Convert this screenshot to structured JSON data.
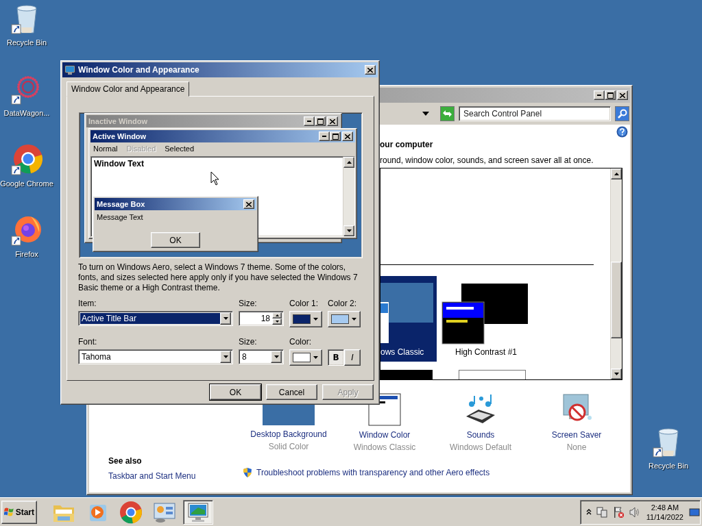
{
  "desktop_icons": [
    {
      "label": "Recycle Bin",
      "kind": "recycle-bin"
    },
    {
      "label": "DataWagon...",
      "kind": "datawagon"
    },
    {
      "label": "Google Chrome",
      "kind": "chrome"
    },
    {
      "label": "Firefox",
      "kind": "firefox"
    }
  ],
  "corner_icon": {
    "label": "Recycle Bin",
    "kind": "recycle-bin"
  },
  "control_panel": {
    "search": {
      "placeholder": "Search Control Panel"
    },
    "heading": "our computer",
    "description": "round, window color, sounds, and screen saver all at once.",
    "themes": [
      {
        "label": "ows Classic",
        "kind": "classic",
        "selected": true
      },
      {
        "label": "High Contrast #1",
        "kind": "high-contrast",
        "selected": false
      }
    ],
    "items": [
      {
        "label": "Desktop Background",
        "detail": "Solid Color",
        "kind": "background"
      },
      {
        "label": "Window Color",
        "detail": "Windows Classic",
        "kind": "window"
      },
      {
        "label": "Sounds",
        "detail": "Windows Default",
        "kind": "sounds"
      },
      {
        "label": "Screen Saver",
        "detail": "None",
        "kind": "screensaver"
      }
    ],
    "see_also": {
      "title": "See also",
      "links": [
        "Taskbar and Start Menu"
      ]
    },
    "troubleshoot": "Troubleshoot problems with transparency and other Aero effects"
  },
  "dialog": {
    "title": "Window Color and Appearance",
    "tabs": [
      {
        "label": "Window Color and Appearance",
        "selected": true
      }
    ],
    "preview": {
      "inactive_title": "Inactive Window",
      "active_title": "Active Window",
      "menu": [
        {
          "label": "Normal",
          "disabled": false
        },
        {
          "label": "Disabled",
          "disabled": true
        },
        {
          "label": "Selected",
          "disabled": false
        }
      ],
      "window_text": "Window Text",
      "message_title": "Message Box",
      "message_text": "Message Text",
      "ok": "OK"
    },
    "note": "To turn on Windows Aero, select a Windows 7 theme.  Some of the colors, fonts, and sizes selected here apply only if you have selected the Windows 7 Basic theme or a High Contrast theme.",
    "item": {
      "label": "Item:",
      "value": "Active Title Bar"
    },
    "item_size": {
      "label": "Size:",
      "value": "18"
    },
    "color1": {
      "label": "Color 1:",
      "color": "#0a246a"
    },
    "color2": {
      "label": "Color 2:",
      "color": "#a6caf0"
    },
    "font": {
      "label": "Font:",
      "value": "Tahoma"
    },
    "font_size": {
      "label": "Size:",
      "value": "8"
    },
    "font_color": {
      "label": "Color:",
      "color": "#ffffff"
    },
    "bold": {
      "label": "B",
      "selected": true
    },
    "italic": {
      "label": "I",
      "selected": false
    },
    "buttons": [
      {
        "label": "OK",
        "disabled": false
      },
      {
        "label": "Cancel",
        "disabled": false
      },
      {
        "label": "Apply",
        "disabled": true
      }
    ]
  },
  "taskbar": {
    "start": "Start",
    "apps": [
      {
        "kind": "explorer",
        "selected": false
      },
      {
        "kind": "media",
        "selected": false
      },
      {
        "kind": "chrome",
        "selected": false
      },
      {
        "kind": "control-panel",
        "selected": false
      },
      {
        "kind": "display",
        "selected": true
      }
    ],
    "clock": {
      "time": "2:48 AM",
      "date": "11/14/2022"
    }
  }
}
